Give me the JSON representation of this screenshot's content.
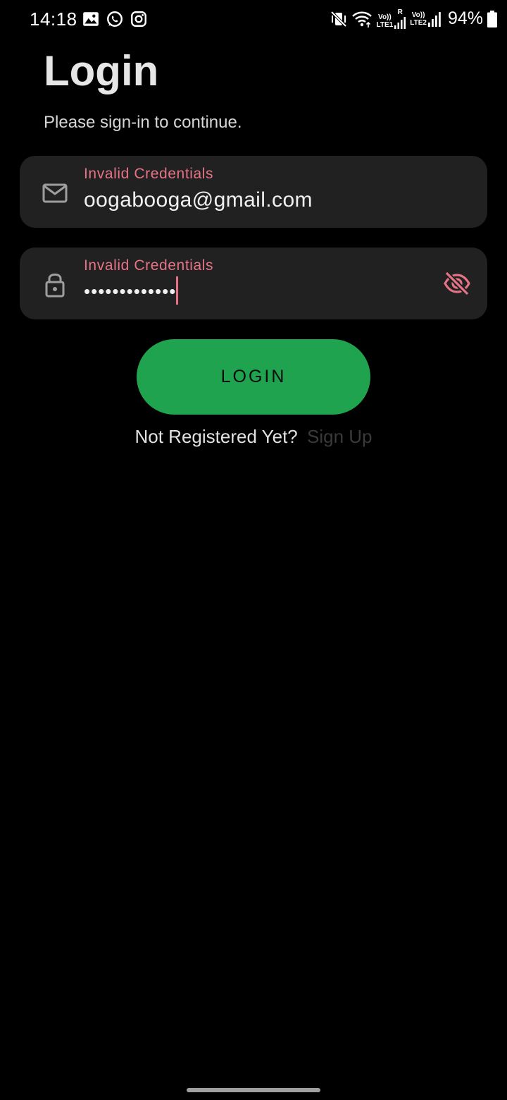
{
  "status_bar": {
    "time": "14:18",
    "left_icons": [
      "gallery-icon",
      "whatsapp-icon",
      "instagram-icon"
    ],
    "right_icons": [
      "mute-vibrate-icon",
      "wifi-icon",
      "signal-lte1-icon",
      "signal-lte2-icon"
    ],
    "sim1_top": "Vo))",
    "sim1_bottom": "LTE1",
    "sim1_roaming": "R",
    "sim2_top": "Vo))",
    "sim2_bottom": "LTE2",
    "battery_percent": "94%"
  },
  "header": {
    "title": "Login",
    "subtitle": "Please sign-in to continue."
  },
  "form": {
    "email": {
      "icon": "mail-icon",
      "error": "Invalid Credentials",
      "value": "oogabooga@gmail.com"
    },
    "password": {
      "icon": "lock-icon",
      "error": "Invalid Credentials",
      "value": "•••••••••••••",
      "toggle_icon": "visibility-off-icon"
    },
    "login_label": "LOGIN"
  },
  "signup": {
    "prompt": "Not Registered Yet?",
    "link": "Sign Up"
  },
  "colors": {
    "background": "#000000",
    "field_background": "#212121",
    "error": "#e57385",
    "primary_button": "#20a34f",
    "link_muted": "#3a3a3a"
  }
}
